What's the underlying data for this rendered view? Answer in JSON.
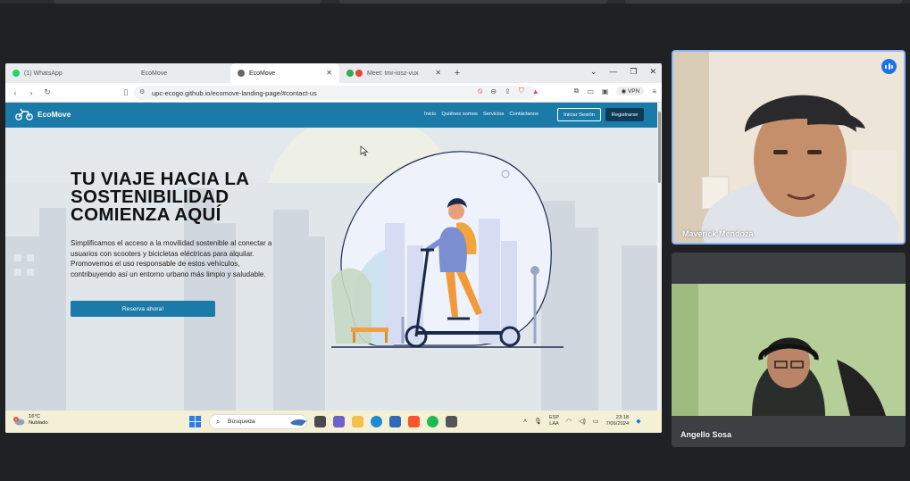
{
  "browser": {
    "tabs": [
      {
        "label": "(1) WhatsApp",
        "color": "#25d366"
      },
      {
        "label": "EcoMove",
        "color": "#e9ebee"
      },
      {
        "label": "EcoMove",
        "color": "#666666",
        "active": true
      },
      {
        "label": "Meet: tmr-iosz-vux",
        "color": "#ea4335"
      }
    ],
    "new_tab": "+",
    "url": "upc-ecogo.github.io/ecomove-landing-page/#contact-us",
    "vpn": "VPN"
  },
  "site": {
    "brand": "EcoMove",
    "nav": [
      "Inicio",
      "Quiénes somos",
      "Servicios",
      "Contáctanos"
    ],
    "login": "Iniciar Sesión",
    "register": "Registrarse",
    "hero_title": "TU VIAJE HACIA LA SOSTENIBILIDAD COMIENZA AQUÍ",
    "hero_text": "Simplificamos el acceso a la movilidad sostenible al conectar a usuarios con scooters y bicicletas eléctricas para alquilar. Promovemos el uso responsable de estos vehículos, contribuyendo así un entorno urbano más limpio y saludable.",
    "cta": "Reserva ahora!",
    "colors": {
      "nav": "#1a7aa8",
      "cta": "#1b7aa8",
      "register": "#0d3a57"
    }
  },
  "taskbar": {
    "weather_temp": "16°C",
    "weather_desc": "Nublado",
    "weather_badge": "1",
    "search": "Búsqueda",
    "lang_1": "ESP",
    "lang_2": "LAA",
    "time": "23:18",
    "date": "7/06/2024"
  },
  "participants": [
    {
      "name": "Maverick Mendoza",
      "speaking": true
    },
    {
      "name": "Angello Sosa",
      "speaking": false
    }
  ]
}
